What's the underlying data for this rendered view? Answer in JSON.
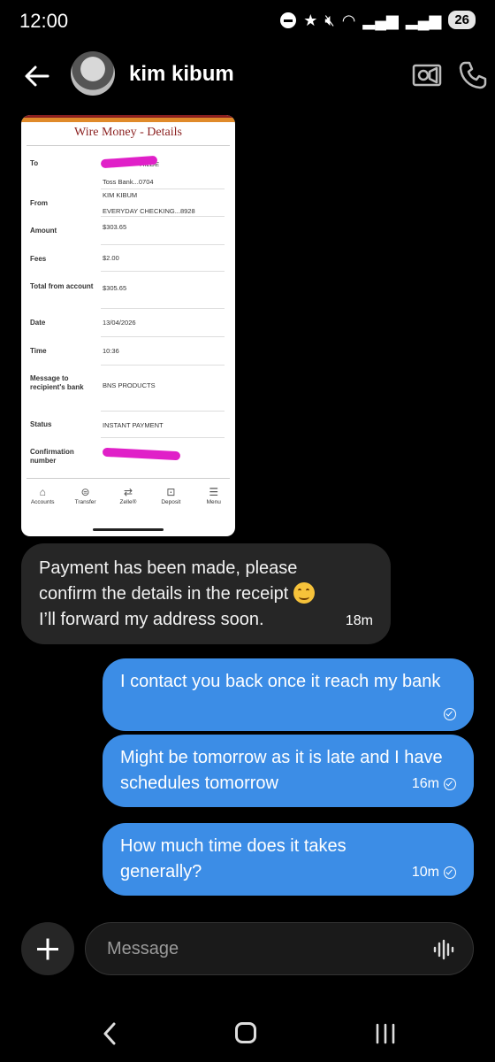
{
  "status_bar": {
    "time": "12:00",
    "battery": "26"
  },
  "header": {
    "contact_name": "kim kibum"
  },
  "receipt": {
    "title": "Wire Money - Details",
    "rows": [
      {
        "label": "To",
        "values": [
          "HILDE",
          "Toss Bank...0704"
        ]
      },
      {
        "label": "From",
        "values": [
          "KIM KIBUM",
          "EVERYDAY CHECKING...8928"
        ]
      },
      {
        "label": "Amount",
        "values": [
          "$303.65"
        ]
      },
      {
        "label": "Fees",
        "values": [
          "$2.00"
        ]
      },
      {
        "label": "Total from account",
        "values": [
          "$305.65"
        ]
      },
      {
        "label": "Date",
        "values": [
          "13/04/2026"
        ]
      },
      {
        "label": "Time",
        "values": [
          "10:36"
        ]
      },
      {
        "label": "Message to recipient's bank",
        "values": [
          "BNS PRODUCTS"
        ]
      },
      {
        "label": "Status",
        "values": [
          "INSTANT PAYMENT"
        ]
      },
      {
        "label": "Confirmation number",
        "values": []
      }
    ],
    "nav": [
      "Accounts",
      "Transfer",
      "Zelle®",
      "Deposit",
      "Menu"
    ],
    "accent_color": "#8a1f1f",
    "redaction_color": "#e020c8"
  },
  "messages": [
    {
      "direction": "incoming",
      "text_line1": "Payment has been made, please",
      "text_line2": "confirm the details in the receipt",
      "text_line3": "I’ll forward my address soon.",
      "time": "18m"
    },
    {
      "direction": "outgoing",
      "text": "I contact you back once it reach my bank",
      "time": ""
    },
    {
      "direction": "outgoing",
      "text": "Might be tomorrow as it is late and I have schedules tomorrow",
      "time": "16m"
    },
    {
      "direction": "outgoing",
      "text": "How much time does it takes generally?",
      "time": "10m"
    }
  ],
  "composer": {
    "placeholder": "Message"
  },
  "colors": {
    "outgoing_bubble": "#3c8de6",
    "incoming_bubble": "#262626",
    "background": "#000000"
  }
}
